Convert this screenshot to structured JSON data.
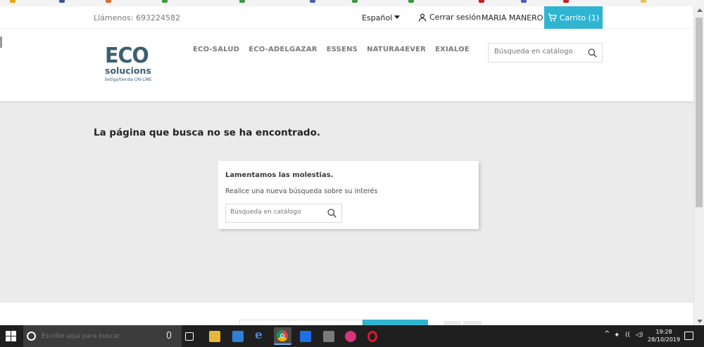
{
  "topbar": {
    "phone": "Llámenos: 693224582",
    "language": "Español",
    "logout": "Cerrar sesión",
    "user": "MARIA MANERO",
    "cart": "Carrito (1)"
  },
  "logo": {
    "line1": "ECO",
    "line2": "solucions",
    "tagline": "botiga/tienda ON-LINE"
  },
  "menu": [
    "ECO-SALUD",
    "ECO-ADELGAZAR",
    "ESSENS",
    "NATURA4EVER",
    "EXIALOE"
  ],
  "search": {
    "placeholder": "Búsqueda en catálogo"
  },
  "main": {
    "title": "La página que busca no se ha encontrado.",
    "card_heading": "Lamentamos las molestias.",
    "card_text": "Realice una nueva búsqueda sobre su interés",
    "card_search_placeholder": "Búsqueda en catálogo"
  },
  "taskbar": {
    "search_placeholder": "Escribe aquí para buscar",
    "time": "19:28",
    "date": "28/10/2019"
  },
  "colors": {
    "accent": "#2fb5d2",
    "logo": "#3c5f73"
  }
}
